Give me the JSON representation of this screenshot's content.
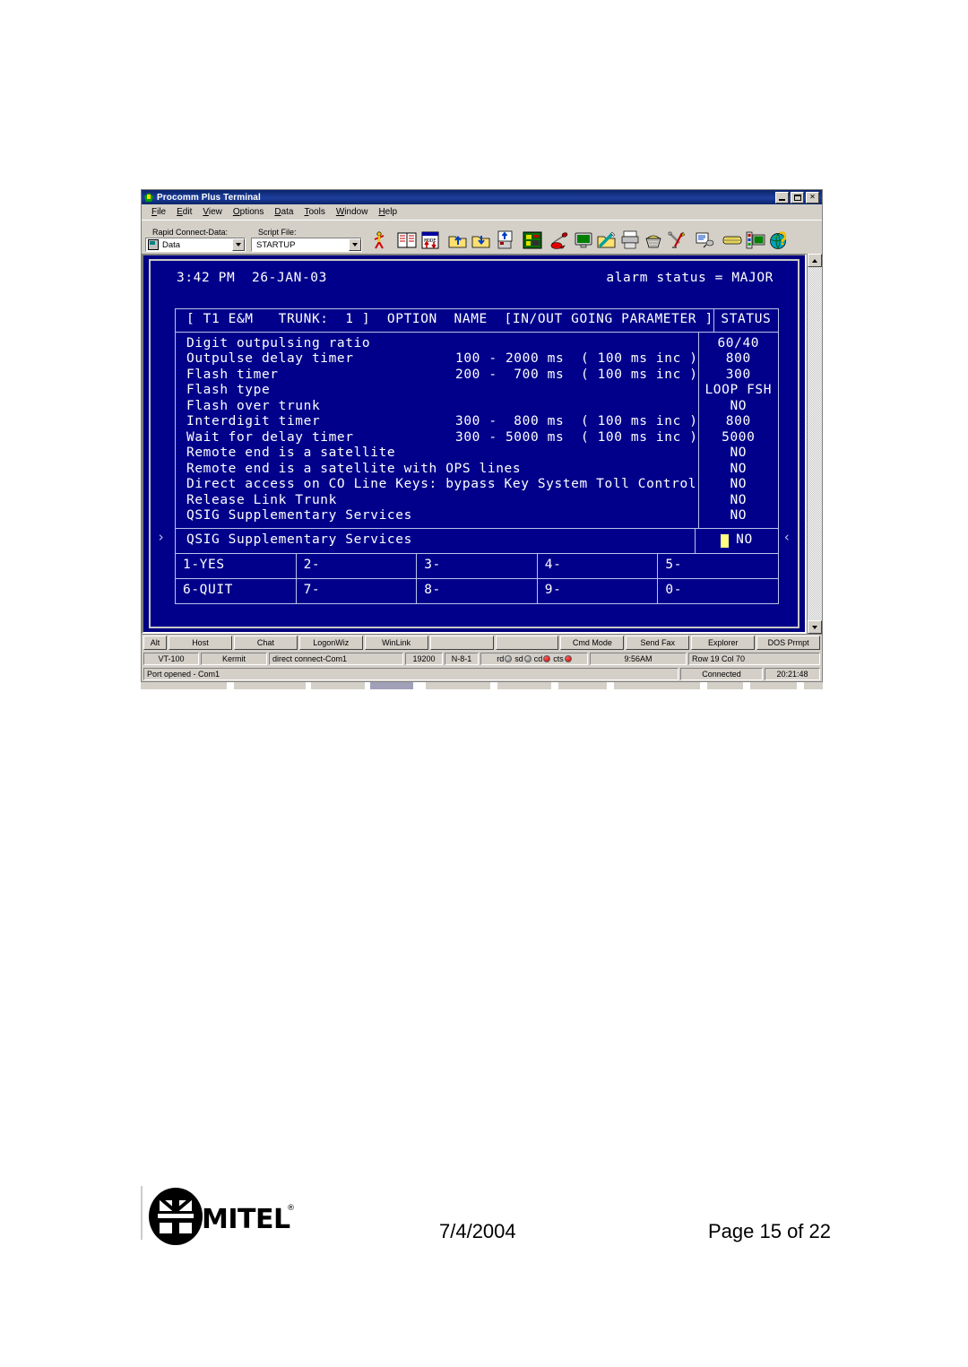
{
  "window": {
    "title": "Procomm Plus Terminal",
    "titlebar_icon": "procomm-leaf-icon",
    "minimize_label": "_",
    "maximize_label": "□",
    "close_label": "×",
    "accent_title_color": "#0a246a",
    "chrome_color": "#d4d0c8"
  },
  "menubar": {
    "items": [
      {
        "label": "File",
        "accel": "F"
      },
      {
        "label": "Edit",
        "accel": "E"
      },
      {
        "label": "View",
        "accel": "V"
      },
      {
        "label": "Options",
        "accel": "O"
      },
      {
        "label": "Data",
        "accel": "D"
      },
      {
        "label": "Tools",
        "accel": "T"
      },
      {
        "label": "Window",
        "accel": "W"
      },
      {
        "label": "Help",
        "accel": "H"
      }
    ]
  },
  "toolbar": {
    "rapid_connect": {
      "label": "Rapid Connect-Data:",
      "value": "Data",
      "icon": "data-connection-icon"
    },
    "script_file": {
      "label": "Script File:",
      "value": "STARTUP",
      "placeholder": "Script File"
    },
    "buttons": [
      {
        "name": "run-script-icon",
        "tip": "Run Script"
      },
      {
        "name": "address-book-icon",
        "tip": "Connection Directory"
      },
      {
        "name": "mode-switch-icon",
        "tip": "Mode"
      },
      {
        "name": "upload-folder-icon",
        "tip": "Send File"
      },
      {
        "name": "download-folder-icon",
        "tip": "Receive File"
      },
      {
        "name": "clipboard-upload-icon",
        "tip": "Clipboard Send"
      },
      {
        "name": "circuit-board-icon",
        "tip": "Setup"
      },
      {
        "name": "phone-dial-icon",
        "tip": "Dial"
      },
      {
        "name": "terminal-screen-icon",
        "tip": "Terminal"
      },
      {
        "name": "pen-folder-icon",
        "tip": "Edit Script"
      },
      {
        "name": "printer-icon",
        "tip": "Print"
      },
      {
        "name": "basket-icon",
        "tip": "Capture"
      },
      {
        "name": "tools-icon",
        "tip": "Tools"
      },
      {
        "name": "meta-key-icon",
        "tip": "Meta Keys"
      },
      {
        "name": "keyboard-icon",
        "tip": "Keyboard Mapping"
      },
      {
        "name": "monitor-settings-icon",
        "tip": "Display Settings"
      },
      {
        "name": "globe-help-icon",
        "tip": "Web Help"
      }
    ]
  },
  "terminal": {
    "time": "3:42 PM",
    "date": "26-JAN-03",
    "alarm_status_text": "alarm status = MAJOR",
    "alarm_status_value": "MAJOR",
    "header_left": "[ T1 E&M   TRUNK:  1 ]  OPTION  NAME  [IN/OUT GOING PARAMETER ]",
    "header_right": "STATUS",
    "scroll_marker_left": "›",
    "scroll_marker_right": "‹",
    "rows": [
      {
        "name": "Digit outpulsing ratio",
        "range": "",
        "status": "60/40"
      },
      {
        "name": "Outpulse delay timer",
        "range": "100 - 2000 ms  ( 100 ms inc )",
        "status": "800"
      },
      {
        "name": "Flash timer",
        "range": "200 -  700 ms  ( 100 ms inc )",
        "status": "300"
      },
      {
        "name": "Flash type",
        "range": "",
        "status": "LOOP FSH"
      },
      {
        "name": "Flash over trunk",
        "range": "",
        "status": "NO"
      },
      {
        "name": "Interdigit timer",
        "range": "300 -  800 ms  ( 100 ms inc )",
        "status": "800"
      },
      {
        "name": "Wait for delay timer",
        "range": "300 - 5000 ms  ( 100 ms inc )",
        "status": "5000"
      },
      {
        "name": "Remote end is a satellite",
        "range": "",
        "status": "NO"
      },
      {
        "name": "Remote end is a satellite with OPS lines",
        "range": "",
        "status": "NO"
      },
      {
        "name": "Direct access on CO Line Keys: bypass Key System Toll Control",
        "range": "",
        "status": "NO"
      },
      {
        "name": "Release Link Trunk",
        "range": "",
        "status": "NO"
      },
      {
        "name": "QSIG Supplementary Services",
        "range": "",
        "status": "NO"
      }
    ],
    "selected_row": {
      "name": "QSIG Supplementary Services",
      "status": "NO",
      "cursor_color": "#ffff80"
    },
    "function_keys": [
      {
        "label": "1-YES"
      },
      {
        "label": "2-"
      },
      {
        "label": "3-"
      },
      {
        "label": "4-"
      },
      {
        "label": "5-"
      },
      {
        "label": "6-QUIT"
      },
      {
        "label": "7-"
      },
      {
        "label": "8-"
      },
      {
        "label": "9-"
      },
      {
        "label": "0-"
      }
    ],
    "background_color": "#00008b",
    "text_color": "#ffffff"
  },
  "button_row": {
    "alt_label": "Alt",
    "buttons": [
      {
        "label": "Host"
      },
      {
        "label": "Chat"
      },
      {
        "label": "LogonWiz"
      },
      {
        "label": "WinLink"
      },
      {
        "label": ""
      },
      {
        "label": ""
      },
      {
        "label": "Cmd Mode"
      },
      {
        "label": "Send Fax"
      },
      {
        "label": "Explorer"
      },
      {
        "label": "DOS Prmpt"
      }
    ]
  },
  "status_bar": {
    "emulation": "VT-100",
    "protocol": "Kermit",
    "connection": "direct connect-Com1",
    "baud": "19200",
    "framing": "N-8-1",
    "leds": [
      {
        "label": "rd",
        "state": "off"
      },
      {
        "label": "sd",
        "state": "off"
      },
      {
        "label": "cd",
        "state": "on"
      },
      {
        "label": "cts",
        "state": "on"
      }
    ],
    "clock": "9:56AM",
    "cursor_position": "Row 19  Col 70",
    "led_on_color": "#c00000",
    "led_off_color": "#808080"
  },
  "status_bar2": {
    "message": "Port opened - Com1",
    "connection_state": "Connected",
    "elapsed": "20:21:48"
  },
  "footer": {
    "logo_text": "MITEL",
    "logo_mark": "mitel-globe-logo",
    "registered_mark": "®",
    "date": "7/4/2004",
    "page": "Page 15 of 22"
  }
}
